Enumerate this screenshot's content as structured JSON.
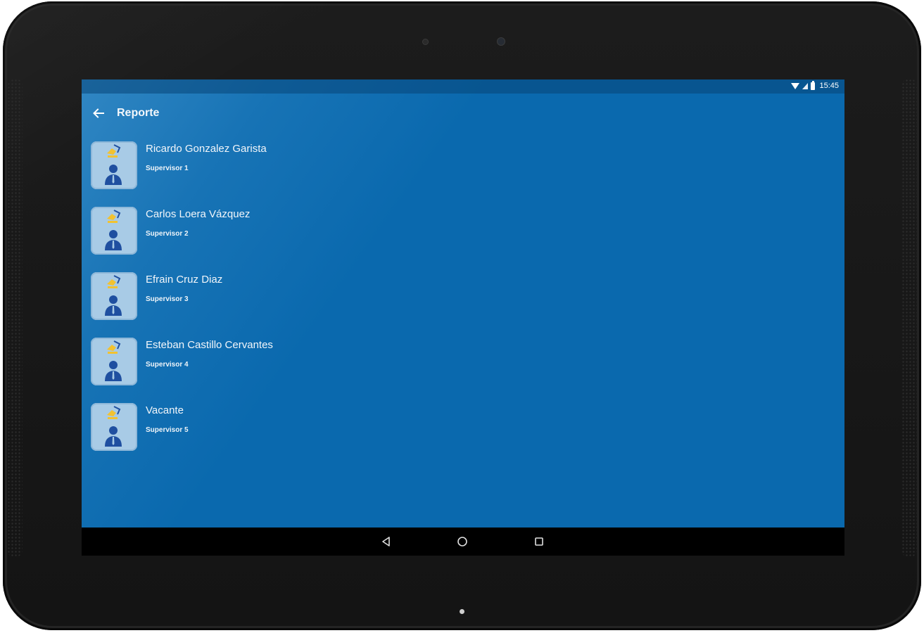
{
  "status_bar": {
    "time": "15:45",
    "icons": [
      "wifi-icon",
      "signal-icon",
      "battery-icon"
    ]
  },
  "app_bar": {
    "back_icon": "arrow-left-icon",
    "title": "Reporte"
  },
  "supervisors": [
    {
      "name": "Ricardo Gonzalez Garista",
      "role": "Supervisor 1",
      "avatar_icon": "supervisor-avatar-icon"
    },
    {
      "name": "Carlos Loera Vázquez",
      "role": "Supervisor 2",
      "avatar_icon": "supervisor-avatar-icon"
    },
    {
      "name": "Efrain Cruz Diaz",
      "role": "Supervisor 3",
      "avatar_icon": "supervisor-avatar-icon"
    },
    {
      "name": "Esteban Castillo Cervantes",
      "role": "Supervisor 4",
      "avatar_icon": "supervisor-avatar-icon"
    },
    {
      "name": "Vacante",
      "role": "Supervisor 5",
      "avatar_icon": "supervisor-avatar-icon"
    }
  ],
  "nav_bar": {
    "icons": [
      "triangle-back-icon",
      "circle-home-icon",
      "square-recents-icon"
    ]
  },
  "colors": {
    "primary": "#0a69ae",
    "avatar_bg": "#a8cbe6",
    "avatar_figure": "#1f4fa0",
    "accent_yellow": "#f2c230"
  }
}
